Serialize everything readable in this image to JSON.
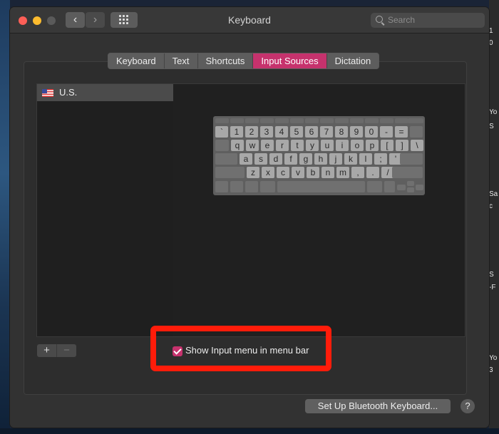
{
  "window": {
    "title": "Keyboard"
  },
  "search": {
    "placeholder": "Search"
  },
  "nav": {
    "back_icon": "‹",
    "forward_icon": "›"
  },
  "tabs": [
    {
      "label": "Keyboard",
      "active": false
    },
    {
      "label": "Text",
      "active": false
    },
    {
      "label": "Shortcuts",
      "active": false
    },
    {
      "label": "Input Sources",
      "active": true
    },
    {
      "label": "Dictation",
      "active": false
    }
  ],
  "sources": [
    {
      "label": "U.S.",
      "icon": "us-flag-icon"
    }
  ],
  "keyboard_rows": [
    [
      "`",
      "1",
      "2",
      "3",
      "4",
      "5",
      "6",
      "7",
      "8",
      "9",
      "0",
      "-",
      "="
    ],
    [
      "q",
      "w",
      "e",
      "r",
      "t",
      "y",
      "u",
      "i",
      "o",
      "p",
      "[",
      "]",
      "\\"
    ],
    [
      "a",
      "s",
      "d",
      "f",
      "g",
      "h",
      "j",
      "k",
      "l",
      ";",
      "'"
    ],
    [
      "z",
      "x",
      "c",
      "v",
      "b",
      "n",
      "m",
      ",",
      ".",
      "/"
    ]
  ],
  "list_controls": {
    "add": "+",
    "remove": "−"
  },
  "show_menu": {
    "label": "Show Input menu in menu bar",
    "checked": true
  },
  "bluetooth_button": "Set Up Bluetooth Keyboard...",
  "help_label": "?",
  "desktop_fragments": [
    "1",
    "0",
    "Yo",
    "S",
    "Sa",
    "c",
    "S",
    "-F",
    "Yo",
    "3"
  ],
  "colors": {
    "accent": "#c6326d",
    "highlight": "#ff1c0a"
  }
}
